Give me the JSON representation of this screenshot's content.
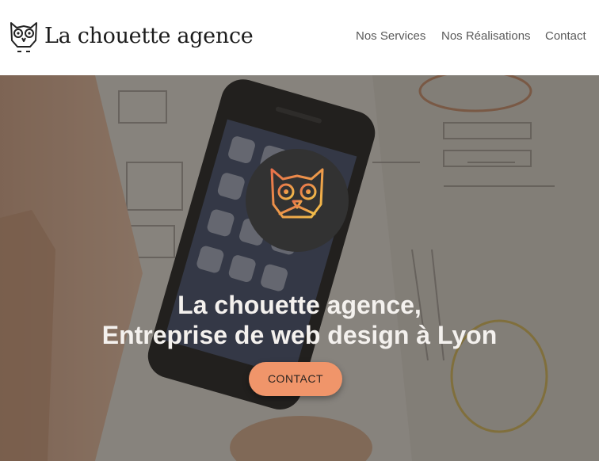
{
  "header": {
    "logo_text": "La chouette agence",
    "nav": [
      {
        "label": "Nos Services"
      },
      {
        "label": "Nos Réalisations"
      },
      {
        "label": "Contact"
      }
    ]
  },
  "hero": {
    "title_line1": "La chouette agence,",
    "title_line2": "Entreprise de web design à Lyon",
    "cta_label": "CONTACT",
    "background_scene": "hands-with-smartphone-over-paper-sketches",
    "badge_icon": "owl-icon"
  },
  "colors": {
    "header_bg": "#ffffff",
    "nav_text": "#5a5a5a",
    "badge_bg": "#323232",
    "cta_bg": "#f0956a",
    "owl_gradient_start": "#e8704a",
    "owl_gradient_end": "#f2c14a"
  }
}
